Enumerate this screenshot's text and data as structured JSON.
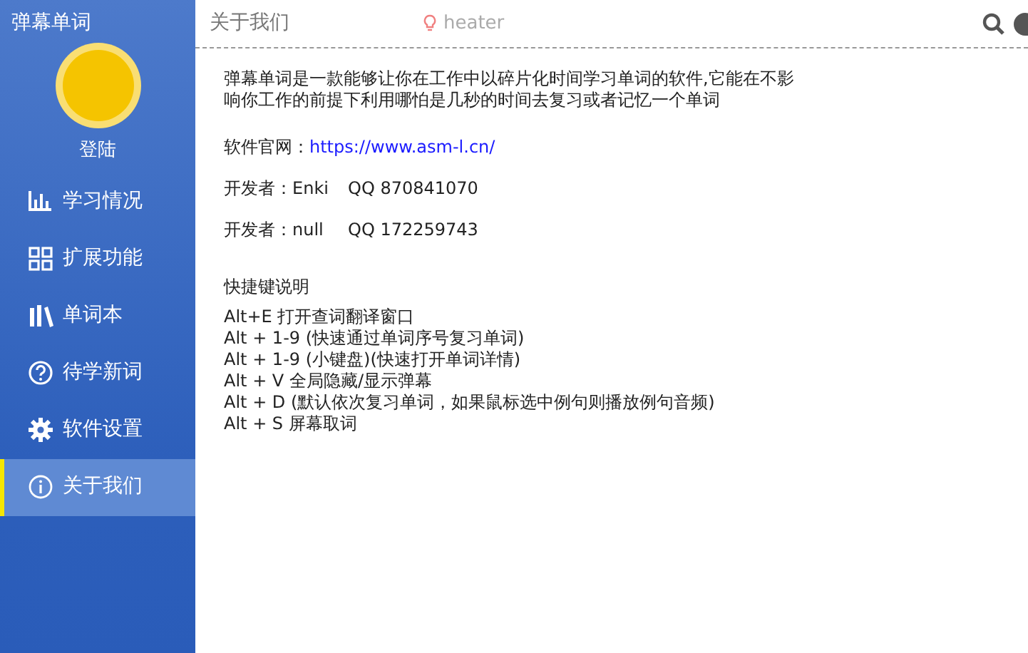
{
  "app_title": "弹幕单词",
  "user": {
    "label": "登陆"
  },
  "nav": [
    {
      "label": "学习情况",
      "selected": false
    },
    {
      "label": "扩展功能",
      "selected": false
    },
    {
      "label": "单词本",
      "selected": false
    },
    {
      "label": "待学新词",
      "selected": false
    },
    {
      "label": "软件设置",
      "selected": false
    },
    {
      "label": "关于我们",
      "selected": true
    }
  ],
  "header": {
    "title": "关于我们",
    "search_placeholder": "heater"
  },
  "about": {
    "intro": "弹幕单词是一款能够让你在工作中以碎片化时间学习单词的软件,它能在不影响你工作的前提下利用哪怕是几秒的时间去复习或者记忆一个单词",
    "website_label": "软件官网：",
    "website_url": "https://www.asm-l.cn/",
    "developers": [
      {
        "label": "开发者：Enki",
        "qq": "QQ 870841070"
      },
      {
        "label": "开发者：null",
        "qq": "QQ 172259743"
      }
    ],
    "shortcuts_title": "快捷键说明",
    "shortcuts": [
      "Alt+E 打开查词翻译窗口",
      "Alt + 1-9 (快速通过单词序号复习单词)",
      "Alt + 1-9 (小键盘)(快速打开单词详情)",
      "Alt + V 全局隐藏/显示弹幕",
      "Alt + D (默认依次复习单词，如果鼠标选中例句则播放例句音频)",
      "Alt + S 屏幕取词"
    ]
  }
}
